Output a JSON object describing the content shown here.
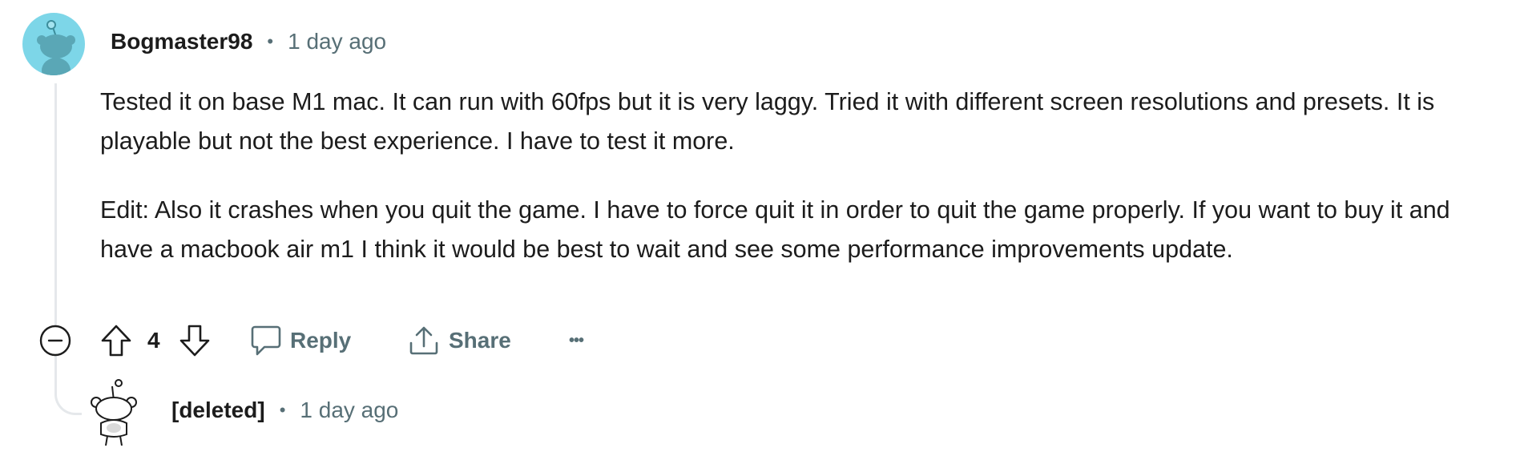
{
  "comment": {
    "author": "Bogmaster98",
    "separator": "•",
    "timestamp": "1 day ago",
    "paragraphs": [
      "Tested it on base M1 mac. It can run with 60fps but it is very laggy. Tried it with different screen resolutions and presets. It is playable but not the best experience. I have to test it more.",
      "Edit: Also it crashes when you quit the game. I have to force quit it in order to quit the game properly. If you want to buy it and have a macbook air m1 I think it would be best to wait and see some performance improvements update."
    ],
    "avatar_icon": "snoo-avatar-icon",
    "avatar_color": "#7dd6e8"
  },
  "actions": {
    "collapse_icon": "minus-circle-icon",
    "upvote_icon": "arrow-up-icon",
    "vote_count": "4",
    "downvote_icon": "arrow-down-icon",
    "reply_icon": "speech-bubble-icon",
    "reply_label": "Reply",
    "share_icon": "share-icon",
    "share_label": "Share",
    "more_label": "•••"
  },
  "reply": {
    "author": "[deleted]",
    "separator": "•",
    "timestamp": "1 day ago",
    "avatar_icon": "snoo-outline-avatar-icon"
  },
  "colors": {
    "text": "#1c1c1c",
    "meta_text": "#576f76",
    "thread_line": "#e5e8eb"
  }
}
